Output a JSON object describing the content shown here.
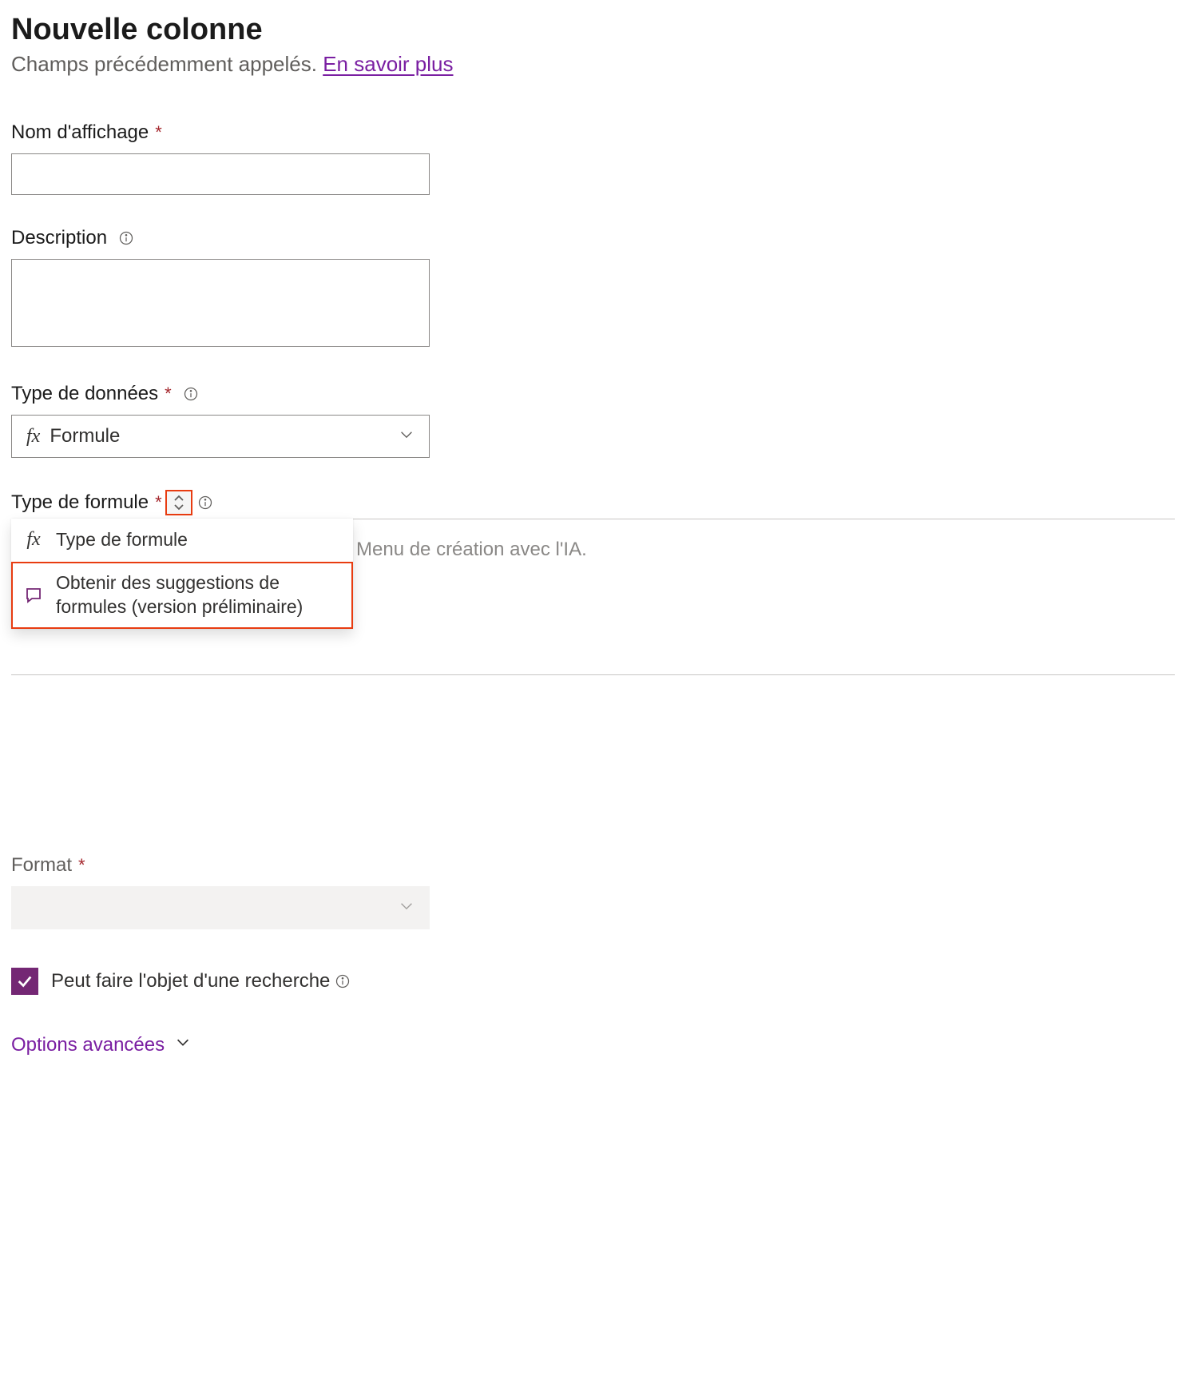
{
  "header": {
    "title": "Nouvelle colonne",
    "subtitle_text": "Champs précédemment appelés. ",
    "subtitle_link": "En savoir plus"
  },
  "fields": {
    "display_name": {
      "label": "Nom d'affichage",
      "value": ""
    },
    "description": {
      "label": "Description",
      "value": ""
    },
    "data_type": {
      "label": "Type de données",
      "selected": "Formule"
    },
    "formula_type": {
      "label": "Type de formule",
      "dropdown": {
        "item1": {
          "label": "Type de formule"
        },
        "item2": {
          "label": "Obtenir des suggestions de formules (version préliminaire)"
        }
      },
      "background_placeholder": "Menu de création avec l'IA."
    },
    "format": {
      "label": "Format",
      "selected": ""
    },
    "searchable": {
      "label": "Peut faire l'objet d'une recherche",
      "checked": true
    }
  },
  "advanced": {
    "label": "Options avancées"
  },
  "required_mark": "*"
}
